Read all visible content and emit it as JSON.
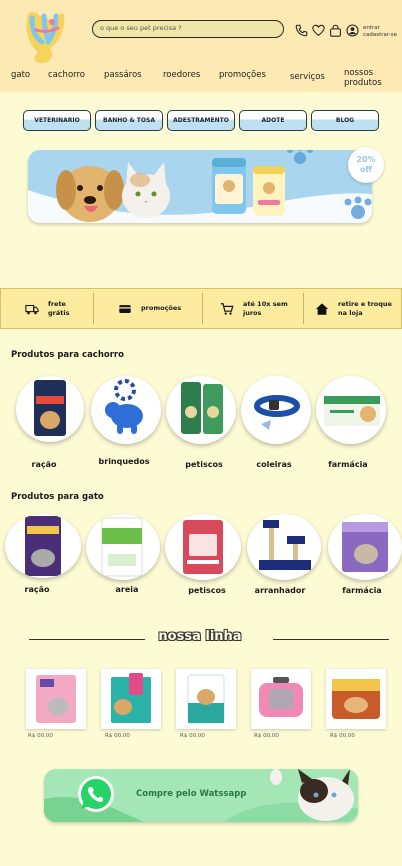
{
  "header": {
    "search_placeholder": "o que o seu pet precisa ?",
    "account_line1": "entrar",
    "account_line2": "cadastrar-se"
  },
  "nav": [
    "gato",
    "cachorro",
    "passáros",
    "roedores",
    "promoções",
    "serviços",
    "nossos",
    "produtos"
  ],
  "categories": [
    "VETERINARIO",
    "BANHO & TOSA",
    "ADESTRAMENTO",
    "ADOTE",
    "BLOG"
  ],
  "banner": {
    "badge_pct": "20%",
    "badge_off": "off"
  },
  "features": [
    {
      "icon": "truck-icon",
      "line1": "frete",
      "line2": "grátis"
    },
    {
      "icon": "card-icon",
      "line1": "promoções",
      "line2": ""
    },
    {
      "icon": "cart-icon",
      "line1": "até 10x sem",
      "line2": "juros"
    },
    {
      "icon": "house-icon",
      "line1": "retire e troque",
      "line2": "na loja"
    }
  ],
  "dog_section": {
    "title": "Produtos para cachorro",
    "items": [
      "ração",
      "brinquedos",
      "petiscos",
      "coleiras",
      "farmácia"
    ]
  },
  "cat_section": {
    "title": "Produtos para gato",
    "items": [
      "ração",
      "areia",
      "petiscos",
      "arranhador",
      "farmácia"
    ]
  },
  "product_line": {
    "title": "nossa linha",
    "prices": [
      "R$ 00,00",
      "R$ 00,00",
      "R$ 00,00",
      "R$ 00,00",
      "R$ 00,00"
    ]
  },
  "whatsapp": {
    "label": "Compre pelo Watssapp"
  },
  "colors": {
    "header_bg": "#fde9b4",
    "page_bg": "#fdfbd4",
    "accent_blue": "#a9d5ef",
    "whatsapp_green": "#25d366"
  }
}
